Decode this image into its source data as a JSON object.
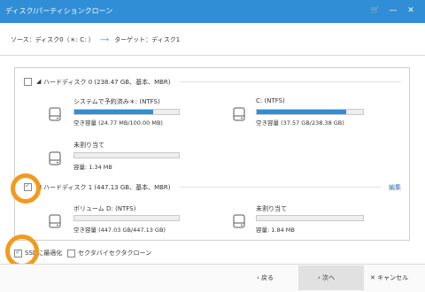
{
  "window": {
    "title": "ディスク/パーティションクローン",
    "cart_icon": "cart-icon",
    "minimize_icon": "minimize-icon",
    "close_icon": "close-icon"
  },
  "source_row": {
    "source_label": "ソース：ディスク0（＊: C: ）",
    "target_label": "ターゲット：ディスク1",
    "arrow_icon": "arrow-right-icon"
  },
  "disks": [
    {
      "header": "ハードディスク 0 (238.47 GB、基本、MBR)",
      "checked": false,
      "partitions": [
        {
          "name": "システムで予約済み＊: (NTFS)",
          "capacity": "空き容量 (24.77 MB/100.00 MB)",
          "used_fraction": 0.75
        },
        {
          "name": "C: (NTFS)",
          "capacity": "空き容量 (37.57 GB/238.38 GB)",
          "used_fraction": 0.84
        },
        {
          "name": "未割り当て",
          "capacity": "容量: 1.34 MB",
          "used_fraction": 0
        }
      ]
    },
    {
      "header": "ハードディスク 1 (447.13 GB、基本、MBR)",
      "checked": true,
      "edit_label": "編集",
      "partitions": [
        {
          "name": "ボリューム D: (NTFS)",
          "capacity": "空き容量 (447.03 GB/447.13 GB)",
          "used_fraction": 0.0
        },
        {
          "name": "未割り当て",
          "capacity": "容量: 1.84 MB",
          "used_fraction": 0
        }
      ]
    }
  ],
  "options": {
    "ssd_label": "SSDに最適化",
    "ssd_checked": true,
    "sector_label": "セクタバイセクタクローン",
    "sector_checked": false
  },
  "footer": {
    "back_label": "戻る",
    "next_label": "次へ",
    "cancel_label": "キャンセル"
  },
  "colors": {
    "accent": "#2f8ed6",
    "highlight_ring": "#f39a1c"
  }
}
